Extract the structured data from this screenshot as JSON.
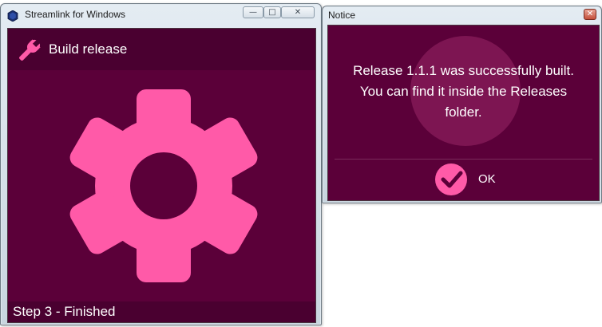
{
  "main_window": {
    "title": "Streamlink for Windows",
    "app_icon": "streamlink-hexagon-icon",
    "caption_buttons": {
      "minimize": "minimize-icon",
      "maximize": "maximize-icon",
      "close": "close-icon"
    },
    "header": {
      "icon": "wrench-icon",
      "label": "Build release"
    },
    "center_icon": "gear-icon",
    "footer": {
      "status": "Step 3 - Finished"
    }
  },
  "notice_window": {
    "title": "Notice",
    "close_icon": "close-icon",
    "message_lines": [
      "Release 1.1.1 was successfully built.",
      "You can find it inside the Releases",
      "folder."
    ],
    "ok_button": {
      "icon": "checkmark-icon",
      "label": "OK"
    }
  },
  "colors": {
    "client_background": "#5b0039",
    "bar_background": "#4a0030",
    "accent_pink": "#ff5aa8",
    "halo": "#7d1552",
    "text": "#ffffff"
  }
}
